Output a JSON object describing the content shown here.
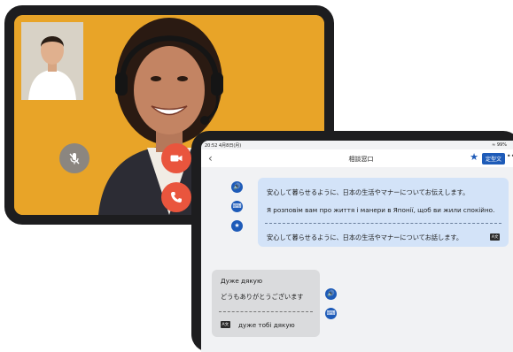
{
  "caller_tablet": {
    "controls": {
      "mute_icon": "mic-off-icon",
      "camera_icon": "video-camera-icon",
      "end_call_icon": "phone-icon"
    },
    "colors": {
      "background": "#e8a428",
      "end_call": "#e9553d",
      "mute": "#8b8680"
    }
  },
  "translator_tablet": {
    "status_bar": {
      "time": "20:52 4月8日(月)",
      "battery": "≈ 99%"
    },
    "header": {
      "back_icon": "chevron-left-icon",
      "title": "相談窓口",
      "favorite_icon": "star-icon",
      "badge": "定型文",
      "more": "•••"
    },
    "messages": [
      {
        "side": "right",
        "original": "安心して暮らせるように、日本の生活やマナーについてお伝えします。",
        "translation": "Я розповім вам про життя і манери в Японії, щоб ви жили спокійно.",
        "back_translation": "安心して暮らせるように、日本の生活やマナーについてお話します。",
        "tag": "A文",
        "icons": [
          "speaker-icon",
          "keyboard-icon",
          "star-icon"
        ]
      },
      {
        "side": "left",
        "original": "Дуже дякую",
        "translation": "どうもありがとうございます",
        "back_translation": "дуже тобі дякую",
        "tag": "A文",
        "icons": [
          "speaker-icon",
          "keyboard-icon"
        ]
      }
    ],
    "colors": {
      "accent": "#1e5bb8",
      "bubble_right": "#d3e3f8",
      "bubble_left": "#dadbdd"
    }
  }
}
